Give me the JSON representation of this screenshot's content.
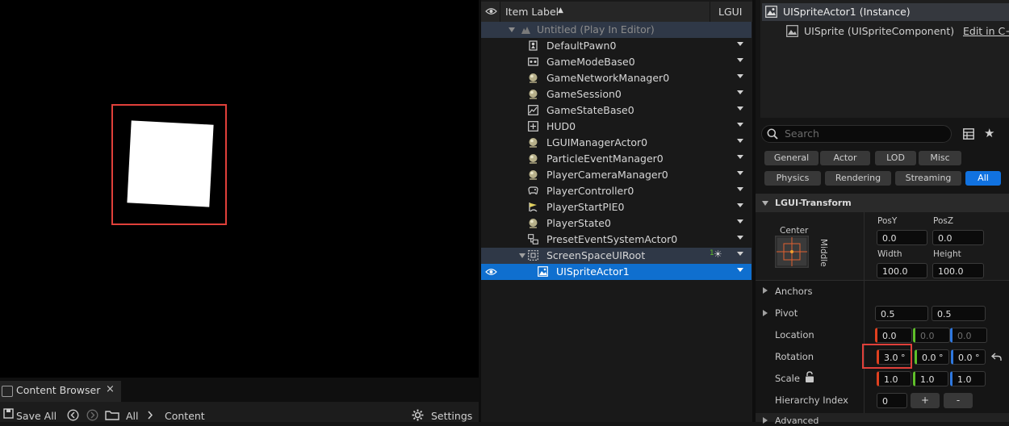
{
  "viewport": {},
  "content_browser": {
    "tab_title": "Content Browser",
    "close_glyph": "×",
    "save_all": "Save All",
    "path_all": "All",
    "path_content": "Content",
    "settings": "Settings"
  },
  "outliner": {
    "header_label": "Item Label",
    "header_sort": "▲",
    "header_col": "LGUI",
    "world": "Untitled (Play In Editor)",
    "items": [
      {
        "label": "DefaultPawn0",
        "icon": "pawn-icon"
      },
      {
        "label": "GameModeBase0",
        "icon": "game-mode-icon"
      },
      {
        "label": "GameNetworkManager0",
        "icon": "actor-sphere-icon"
      },
      {
        "label": "GameSession0",
        "icon": "actor-sphere-icon"
      },
      {
        "label": "GameStateBase0",
        "icon": "game-state-icon"
      },
      {
        "label": "HUD0",
        "icon": "hud-icon"
      },
      {
        "label": "LGUIManagerActor0",
        "icon": "actor-sphere-icon"
      },
      {
        "label": "ParticleEventManager0",
        "icon": "actor-sphere-icon"
      },
      {
        "label": "PlayerCameraManager0",
        "icon": "actor-sphere-icon"
      },
      {
        "label": "PlayerController0",
        "icon": "gamepad-icon"
      },
      {
        "label": "PlayerStartPIE0",
        "icon": "player-start-icon"
      },
      {
        "label": "PlayerState0",
        "icon": "actor-sphere-icon"
      },
      {
        "label": "PresetEventSystemActor0",
        "icon": "event-system-icon"
      },
      {
        "label": "ScreenSpaceUIRoot",
        "icon": "ui-root-icon",
        "badge": "1"
      },
      {
        "label": "UISpriteActor1",
        "icon": "ui-sprite-icon",
        "selected": true
      }
    ]
  },
  "details": {
    "instance_title": "UISpriteActor1 (Instance)",
    "component": "UISprite (UISpriteComponent)",
    "edit_link": "Edit in C++",
    "search_placeholder": "Search",
    "filters_row1": [
      "General",
      "Actor",
      "LOD",
      "Misc"
    ],
    "filters_row2": [
      "Physics",
      "Rendering",
      "Streaming",
      "All"
    ],
    "active_filter": "All",
    "section": "LGUI-Transform",
    "anchor_preset_top": "Center",
    "anchor_preset_side": "Middle",
    "posy_label": "PosY",
    "posz_label": "PosZ",
    "posy": "0.0",
    "posz": "0.0",
    "width_label": "Width",
    "height_label": "Height",
    "width": "100.0",
    "height": "100.0",
    "anchors": "Anchors",
    "pivot": "Pivot",
    "pivot_x": "0.5",
    "pivot_y": "0.5",
    "location": "Location",
    "location_vals": [
      "0.0",
      "0.0",
      "0.0"
    ],
    "rotation": "Rotation",
    "rotation_vals": [
      "3.0 °",
      "0.0 °",
      "0.0 °"
    ],
    "scale": "Scale",
    "scale_vals": [
      "1.0",
      "1.0",
      "1.0"
    ],
    "hierarchy_index": "Hierarchy Index",
    "hierarchy_val": "0",
    "plus": "+",
    "minus": "-",
    "advanced": "Advanced"
  },
  "colors": {
    "selection_blue": "#0f6fcf",
    "active_filter_blue": "#1172e0",
    "highlight_red": "#e0403a",
    "axis_x": "#e0401f",
    "axis_y": "#5fbf2a",
    "axis_z": "#2e78e0"
  }
}
